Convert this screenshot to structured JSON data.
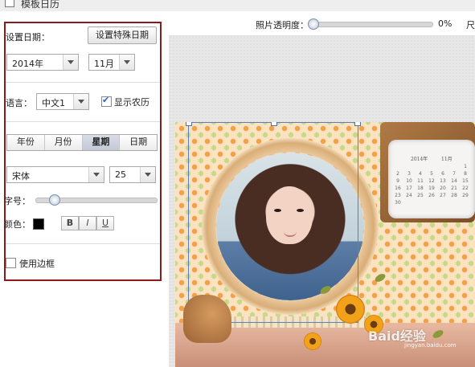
{
  "window": {
    "title": "模板日历"
  },
  "settings": {
    "set_date_label": "设置日期：",
    "special_date_button": "设置特殊日期",
    "year_value": "2014年",
    "month_value": "11月",
    "language_label": "语言：",
    "language_value": "中文1",
    "show_lunar_label": "显示农历",
    "show_lunar_checked": true,
    "format_tabs": [
      {
        "label": "年份",
        "active": false
      },
      {
        "label": "月份",
        "active": false
      },
      {
        "label": "星期",
        "active": true
      },
      {
        "label": "日期",
        "active": false
      }
    ],
    "font_value": "宋体",
    "font_size_value": "25",
    "size_label": "字号：",
    "font_size_slider_fraction": 0.12,
    "color_label": "颜色：",
    "color_value": "#000000",
    "bold_label": "B",
    "italic_label": "I",
    "underline_label": "U",
    "use_border_label": "使用边框",
    "use_border_checked": false
  },
  "toolbar": {
    "opacity_label": "照片透明度：",
    "opacity_value": "0%",
    "opacity_fraction": 0.0,
    "truncated_label": "尺"
  },
  "calendar_preview": {
    "year_text": "2014年",
    "month_text": "11月",
    "rows": [
      [
        "",
        "",
        "",
        "",
        "",
        "",
        "1"
      ],
      [
        "2",
        "3",
        "4",
        "5",
        "6",
        "7",
        "8"
      ],
      [
        "9",
        "10",
        "11",
        "12",
        "13",
        "14",
        "15"
      ],
      [
        "16",
        "17",
        "18",
        "19",
        "20",
        "21",
        "22"
      ],
      [
        "23",
        "24",
        "25",
        "26",
        "27",
        "28",
        "29"
      ],
      [
        "30",
        "",
        "",
        "",
        "",
        "",
        ""
      ]
    ]
  },
  "watermark": {
    "main": "Baid经验",
    "sub": "jingyan.baidu.com"
  },
  "colors": {
    "panel_outline": "#8b1a1a",
    "selection": "#5a7fbf"
  }
}
